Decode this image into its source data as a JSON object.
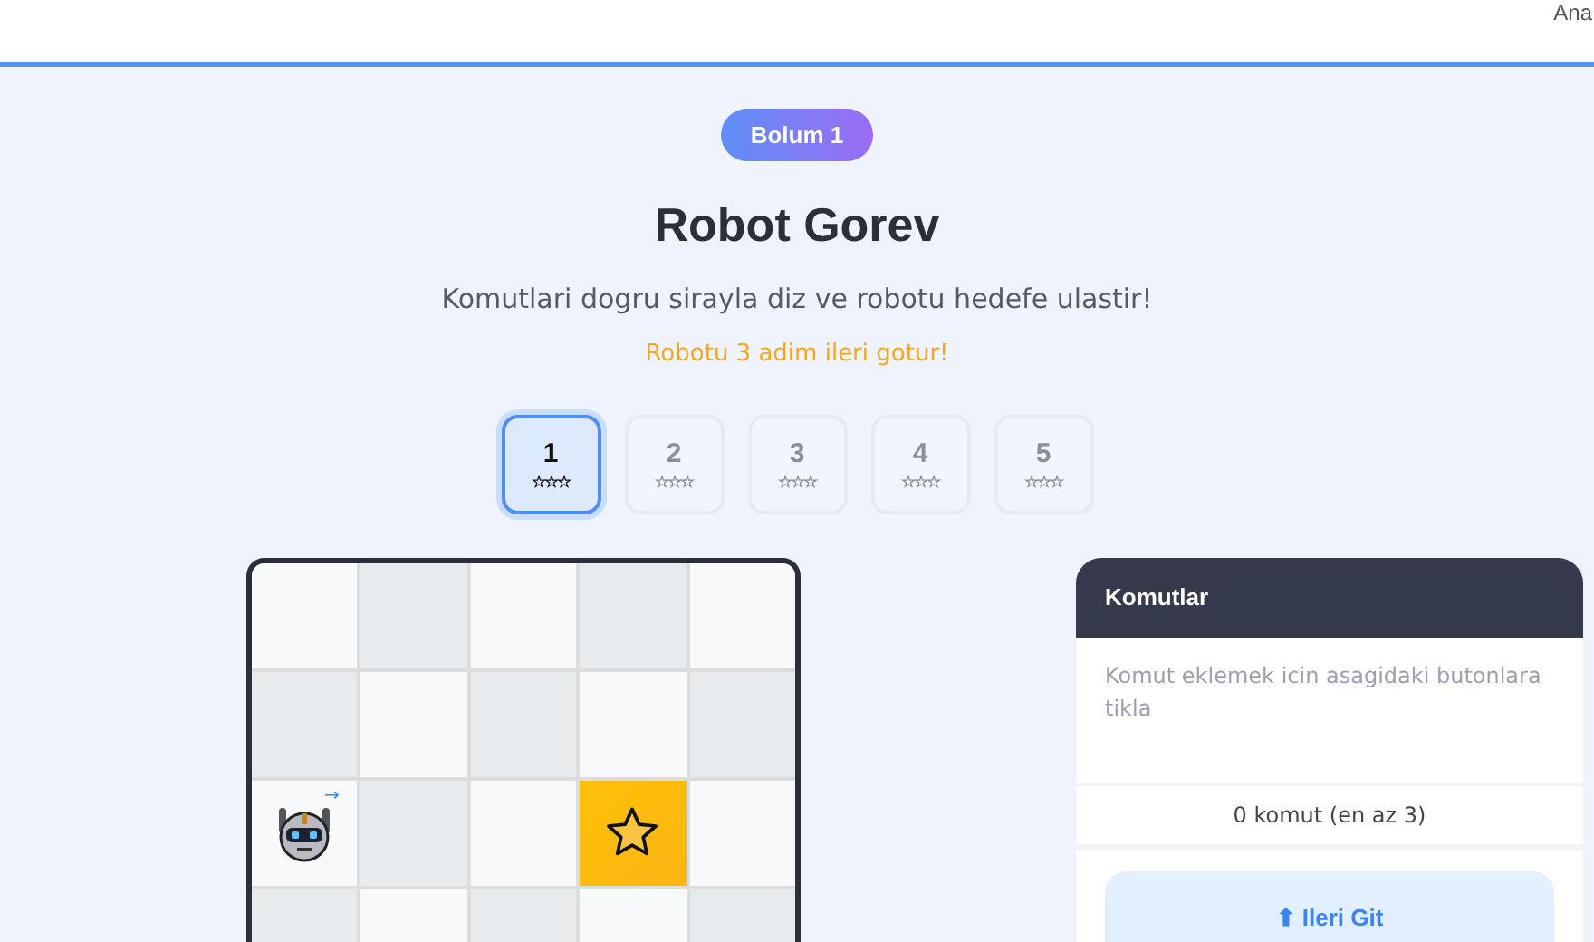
{
  "header": {
    "nav_link": "Ana"
  },
  "level_badge": "Bolum 1",
  "title": "Robot Gorev",
  "subtitle": "Komutlari dogru sirayla diz ve robotu hedefe ulastir!",
  "hint": "Robotu 3 adim ileri gotur!",
  "levels": [
    {
      "number": "1",
      "stars": "☆☆☆",
      "selected": true
    },
    {
      "number": "2",
      "stars": "☆☆☆",
      "selected": false
    },
    {
      "number": "3",
      "stars": "☆☆☆",
      "selected": false
    },
    {
      "number": "4",
      "stars": "☆☆☆",
      "selected": false
    },
    {
      "number": "5",
      "stars": "☆☆☆",
      "selected": false
    }
  ],
  "grid": {
    "rows": [
      {
        "cells": [
          {
            "kind": "empty"
          },
          {
            "kind": "empty"
          },
          {
            "kind": "empty"
          },
          {
            "kind": "empty"
          },
          {
            "kind": "empty"
          }
        ]
      },
      {
        "cells": [
          {
            "kind": "empty"
          },
          {
            "kind": "empty"
          },
          {
            "kind": "empty"
          },
          {
            "kind": "empty"
          },
          {
            "kind": "empty"
          }
        ]
      },
      {
        "cells": [
          {
            "kind": "robot",
            "direction": "→"
          },
          {
            "kind": "empty"
          },
          {
            "kind": "empty"
          },
          {
            "kind": "goal"
          },
          {
            "kind": "empty"
          }
        ]
      },
      {
        "cells": [
          {
            "kind": "empty"
          },
          {
            "kind": "empty"
          },
          {
            "kind": "empty"
          },
          {
            "kind": "empty"
          },
          {
            "kind": "empty"
          }
        ]
      }
    ]
  },
  "commands_panel": {
    "title": "Komutlar",
    "empty_text": "Komut eklemek icin asagidaki butonlara tikla",
    "count": "0 komut (en az 3)",
    "buttons": [
      "⬆ Ileri Git"
    ]
  }
}
